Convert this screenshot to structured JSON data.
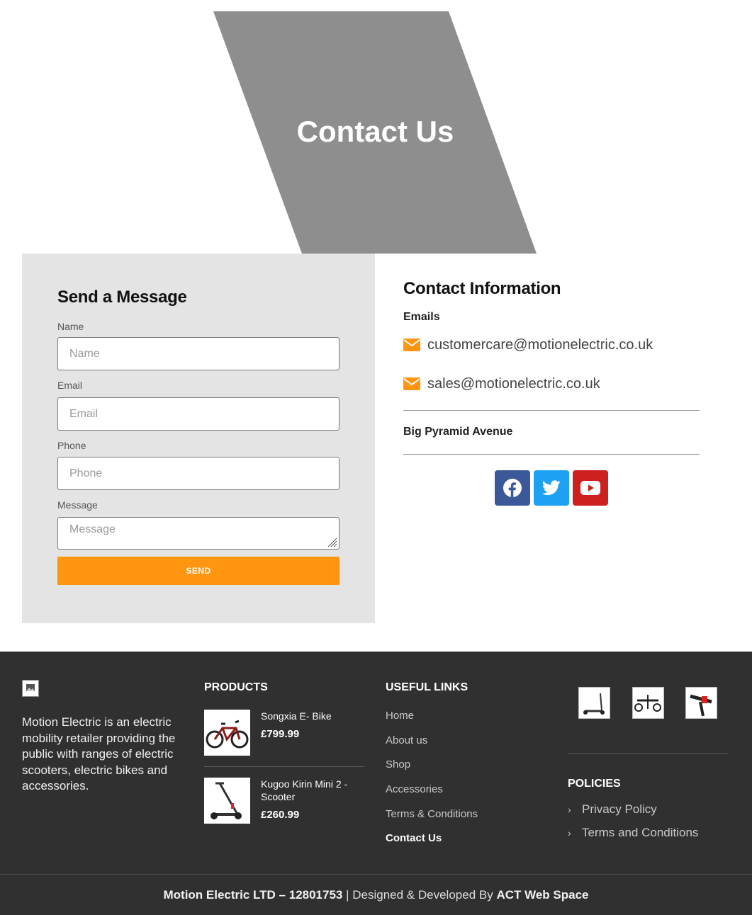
{
  "hero": {
    "title": "Contact Us"
  },
  "form": {
    "heading": "Send a Message",
    "fields": [
      {
        "label": "Name",
        "placeholder": "Name"
      },
      {
        "label": "Email",
        "placeholder": "Email"
      },
      {
        "label": "Phone",
        "placeholder": "Phone"
      },
      {
        "label": "Message",
        "placeholder": "Message"
      }
    ],
    "submit_label": "SEND"
  },
  "contact": {
    "heading": "Contact Information",
    "emails_label": "Emails",
    "emails": [
      "customercare@motionelectric.co.uk",
      "sales@motionelectric.co.uk"
    ],
    "address": "Big Pyramid Avenue",
    "social": [
      "facebook-icon",
      "twitter-icon",
      "youtube-icon"
    ]
  },
  "footer": {
    "about": "Motion Electric is an electric mobility retailer providing the public with ranges of electric scooters, electric bikes and accessories.",
    "products_heading": "PRODUCTS",
    "products": [
      {
        "name": "Songxia E- Bike",
        "price": "£799.99"
      },
      {
        "name": "Kugoo Kirin Mini 2 - Scooter",
        "price": "£260.99"
      }
    ],
    "links_heading": "USEFUL LINKS",
    "links": [
      "Home",
      "About us",
      "Shop",
      "Accessories",
      "Terms & Conditions",
      "Contact Us"
    ],
    "policies_heading": "POLICIES",
    "policies": [
      "Privacy Policy",
      "Terms and Conditions"
    ],
    "bottom": {
      "company": "Motion Electric LTD – 12801753",
      "separator": " | Designed & Developed By ",
      "developer": "ACT Web Space"
    }
  },
  "colors": {
    "accent": "#ff9510",
    "hero_shape": "#8e8e8e",
    "form_bg": "#e4e4e4",
    "footer_bg": "#303030",
    "facebook": "#3b5998",
    "twitter": "#1da1f2",
    "youtube": "#cd201f"
  }
}
